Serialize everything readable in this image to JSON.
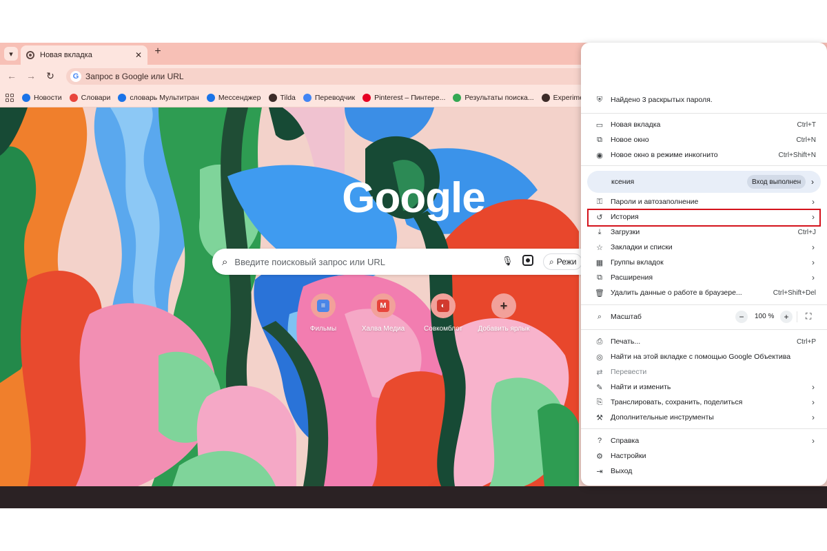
{
  "tab": {
    "title": "Новая вкладка"
  },
  "omnibox": {
    "placeholder": "Запрос в Google или URL"
  },
  "bookmarks": [
    {
      "label": "Новости",
      "color": "#1a73e8",
      "icon": "news-icon"
    },
    {
      "label": "Словари",
      "color": "#e8453c",
      "icon": "dictionary-icon"
    },
    {
      "label": "словарь Мультитран",
      "color": "#1a73e8",
      "icon": "multitran-icon"
    },
    {
      "label": "Мессенджер",
      "color": "#1a73e8",
      "icon": "messenger-icon"
    },
    {
      "label": "Tilda",
      "color": "#3c2b28",
      "icon": "tilda-icon"
    },
    {
      "label": "Переводчик",
      "color": "#4285f4",
      "icon": "translate-icon"
    },
    {
      "label": "Pinterest – Пинтере...",
      "color": "#e60023",
      "icon": "pinterest-icon"
    },
    {
      "label": "Результаты поиска...",
      "color": "#34a853",
      "icon": "search-results-icon"
    },
    {
      "label": "Experimental_Ma",
      "color": "#3c2b28",
      "icon": "experimental-icon"
    }
  ],
  "ntp": {
    "logo": "Google",
    "search_placeholder": "Введите поисковый запрос или URL",
    "mode_label": "Режи",
    "shortcuts": [
      {
        "label": "Фильмы",
        "glyph": "≡",
        "color": "#4a86e8"
      },
      {
        "label": "Халва Медиа",
        "glyph": "M",
        "color": "#e8453c"
      },
      {
        "label": "Совкомблот",
        "glyph": "◐",
        "color": "#d23a2f"
      },
      {
        "label": "Добавить ярлык",
        "glyph": "+",
        "color": "#3c2b28"
      }
    ]
  },
  "menu": {
    "passwords_alert": "Найдено 3 раскрытых пароля.",
    "new_tab": {
      "label": "Новая вкладка",
      "shortcut": "Ctrl+T"
    },
    "new_window": {
      "label": "Новое окно",
      "shortcut": "Ctrl+N"
    },
    "incognito": {
      "label": "Новое окно в режиме инкогнито",
      "shortcut": "Ctrl+Shift+N"
    },
    "profile": {
      "name": "ксения",
      "status": "Вход выполнен"
    },
    "passwords": {
      "label": "Пароли и автозаполнение"
    },
    "history": {
      "label": "История"
    },
    "downloads": {
      "label": "Загрузки",
      "shortcut": "Ctrl+J"
    },
    "bookmarks": {
      "label": "Закладки и списки"
    },
    "tab_groups": {
      "label": "Группы вкладок"
    },
    "extensions": {
      "label": "Расширения"
    },
    "clear_data": {
      "label": "Удалить данные о работе в браузере...",
      "shortcut": "Ctrl+Shift+Del"
    },
    "zoom": {
      "label": "Масштаб",
      "value": "100 %",
      "minus": "−",
      "plus": "+"
    },
    "print": {
      "label": "Печать...",
      "shortcut": "Ctrl+P"
    },
    "lens": {
      "label": "Найти на этой вкладке с помощью Google Объектива"
    },
    "translate": {
      "label": "Перевести"
    },
    "find": {
      "label": "Найти и изменить"
    },
    "cast": {
      "label": "Транслировать, сохранить, поделиться"
    },
    "more_tools": {
      "label": "Дополнительные инструменты"
    },
    "help": {
      "label": "Справка"
    },
    "settings": {
      "label": "Настройки"
    },
    "exit": {
      "label": "Выход"
    }
  },
  "colors": {
    "tabstrip": "#f7c0b6",
    "toolbar": "#fde5df",
    "highlight": "#d4121b"
  }
}
